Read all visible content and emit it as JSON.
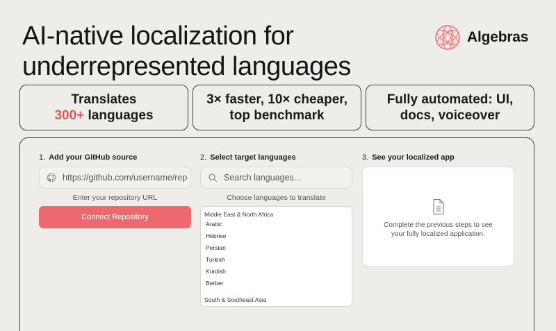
{
  "headline": {
    "line1": "AI-native localization for",
    "line2": "underrepresented languages"
  },
  "brand": {
    "name": "Algebras",
    "logo_icon": "algebras-logo-icon"
  },
  "features": [
    {
      "line1": "Translates",
      "accent": "300+",
      "line2_rest": " languages"
    },
    {
      "line1": "3× faster, 10× cheaper,",
      "line2": "top benchmark"
    },
    {
      "line1": "Fully automated: UI,",
      "line2": "docs,  voiceover"
    }
  ],
  "steps": {
    "source": {
      "number": "1.",
      "title": "Add your GitHub source",
      "input_placeholder": "https://github.com/username/repo",
      "input_icon": "github-icon",
      "hint": "Enter your repository URL",
      "button_label": "Connect Repository"
    },
    "languages": {
      "number": "2.",
      "title": "Select target languages",
      "search_placeholder": "Search languages...",
      "search_icon": "search-icon",
      "hint": "Choose languages to translate",
      "groups": [
        {
          "name": "Middle East & North Africa",
          "items": [
            "Arabic",
            "Hebrew",
            "Persian",
            "Turkish",
            "Kurdish",
            "Berber"
          ]
        },
        {
          "name": "South & Southeast Asia",
          "items": []
        }
      ]
    },
    "preview": {
      "number": "3.",
      "title": "See your localized app",
      "message": "Complete the previous steps to see your fully localized application.",
      "icon": "document-icon"
    }
  },
  "colors": {
    "background": "#efedea",
    "accent": "#e2585e",
    "button": "#ec6a6f",
    "border": "#3d3d3d"
  }
}
